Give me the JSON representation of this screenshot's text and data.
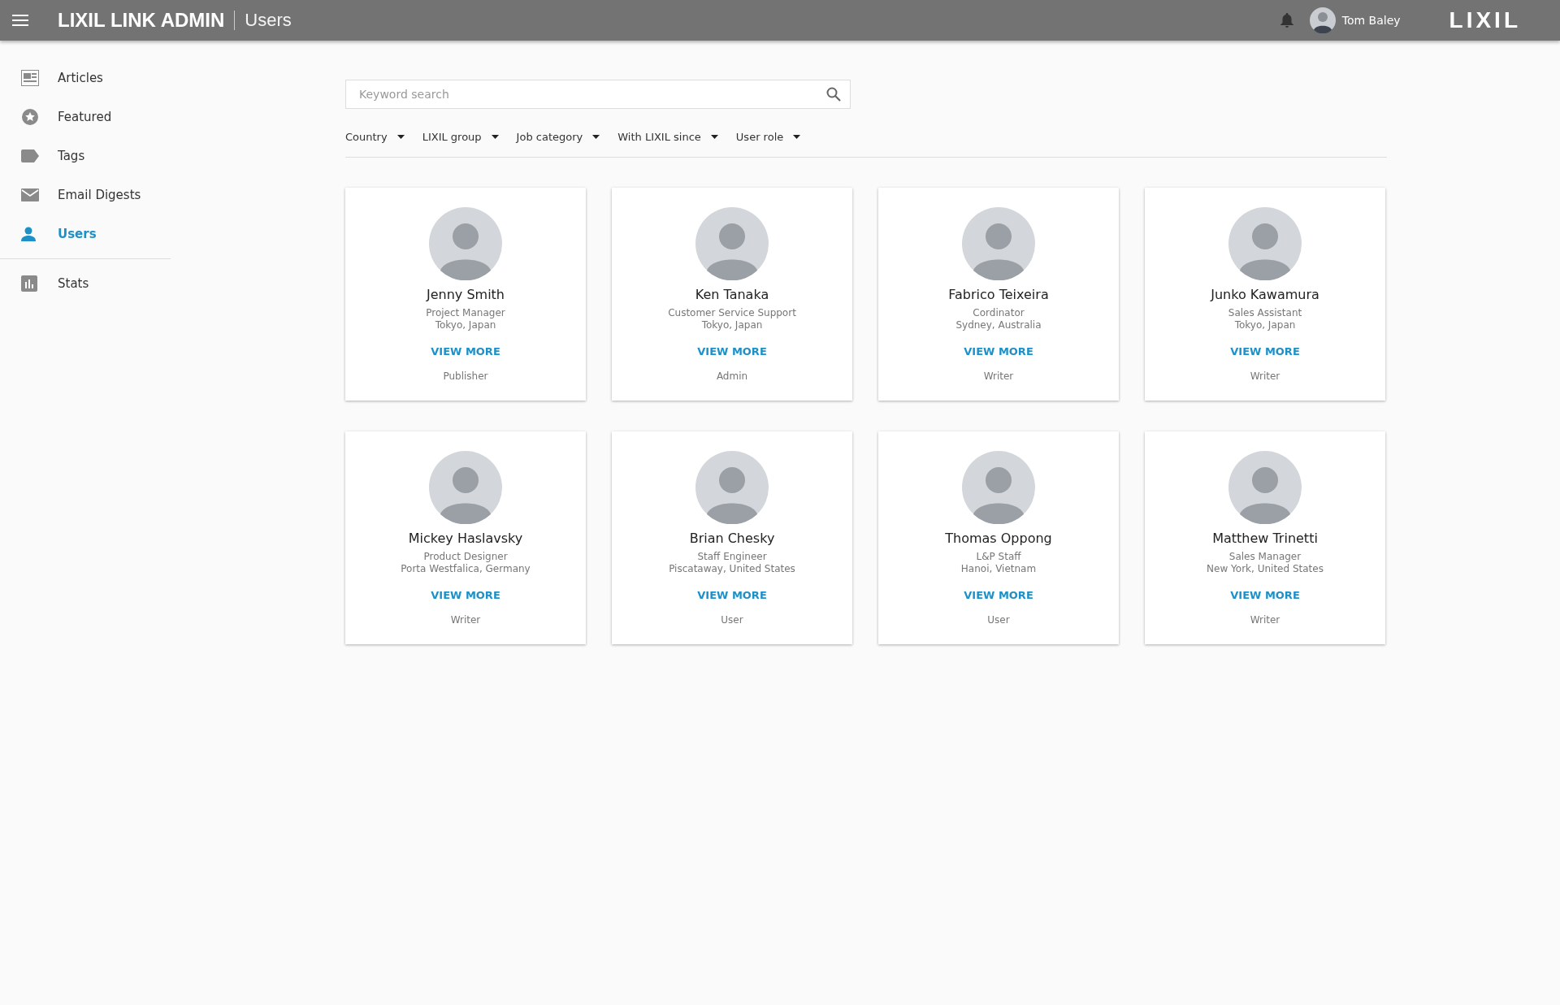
{
  "header": {
    "title": "LIXIL LINK ADMIN",
    "section": "Users",
    "user_name": "Tom Baley",
    "logo": "LIXIL"
  },
  "sidebar": {
    "sections": [
      {
        "items": [
          {
            "label": "Articles",
            "kind": "articles",
            "selected": false
          },
          {
            "label": "Featured",
            "kind": "featured",
            "selected": false
          },
          {
            "label": "Tags",
            "kind": "tags",
            "selected": false
          },
          {
            "label": "Email Digests",
            "kind": "email",
            "selected": false
          },
          {
            "label": "Users",
            "kind": "users",
            "selected": true
          }
        ]
      },
      {
        "items": [
          {
            "label": "Stats",
            "kind": "stats",
            "selected": false
          }
        ]
      }
    ]
  },
  "search": {
    "placeholder": "Keyword search"
  },
  "filters": [
    "Country",
    "LIXIL group",
    "Job category",
    "With LIXIL since",
    "User role"
  ],
  "users": [
    {
      "name": "Jenny Smith",
      "job": "Project Manager",
      "location": "Tokyo, Japan",
      "link": "VIEW MORE",
      "role": "Publisher"
    },
    {
      "name": "Ken Tanaka",
      "job": "Customer Service Support",
      "location": "Tokyo, Japan",
      "link": "VIEW MORE",
      "role": "Admin"
    },
    {
      "name": "Fabrico Teixeira",
      "job": "Cordinator",
      "location": "Sydney, Australia",
      "link": "VIEW MORE",
      "role": "Writer"
    },
    {
      "name": "Junko Kawamura",
      "job": "Sales Assistant",
      "location": "Tokyo, Japan",
      "link": "VIEW MORE",
      "role": "Writer"
    },
    {
      "name": "Mickey Haslavsky",
      "job": "Product Designer",
      "location": "Porta Westfalica, Germany",
      "link": "VIEW MORE",
      "role": "Writer"
    },
    {
      "name": "Brian Chesky",
      "job": "Staff Engineer",
      "location": "Piscataway, United States",
      "link": "VIEW MORE",
      "role": "User"
    },
    {
      "name": "Thomas Oppong",
      "job": "L&P Staff",
      "location": "Hanoi, Vietnam",
      "link": "VIEW MORE",
      "role": "User"
    },
    {
      "name": "Matthew Trinetti",
      "job": "Sales Manager",
      "location": "New York, United States",
      "link": "VIEW MORE",
      "role": "Writer"
    }
  ]
}
